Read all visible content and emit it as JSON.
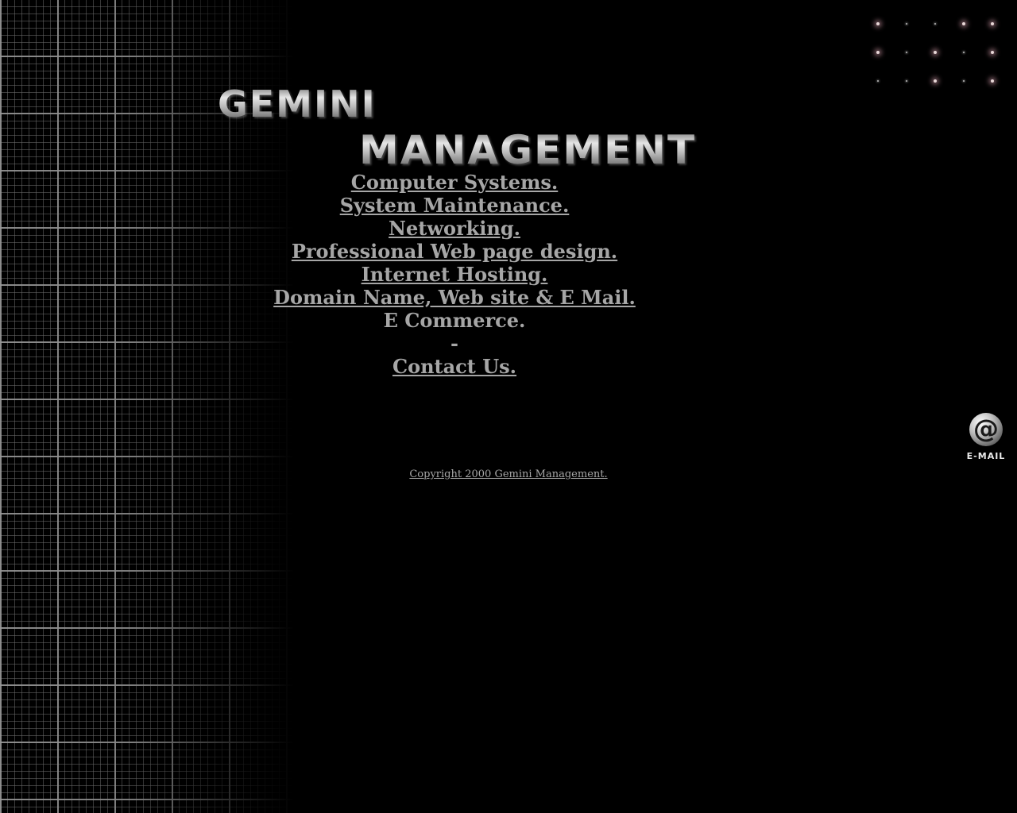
{
  "logo": {
    "line1": "GEMINI",
    "line2": "MANAGEMENT"
  },
  "menu": {
    "items": [
      {
        "label": "Computer Systems.",
        "link": true
      },
      {
        "label": "System Maintenance.",
        "link": true
      },
      {
        "label": "Networking.",
        "link": true
      },
      {
        "label": "Professional Web page design.",
        "link": true
      },
      {
        "label": "Internet Hosting.",
        "link": true
      },
      {
        "label": "Domain Name, Web site & E Mail.",
        "link": true
      },
      {
        "label": "E Commerce.",
        "link": false
      },
      {
        "label": "-",
        "link": false
      },
      {
        "label": "Contact Us.",
        "link": true
      }
    ]
  },
  "email": {
    "symbol": "@",
    "label": "E-MAIL",
    "icon": "at-icon"
  },
  "footer": {
    "copyright": "Copyright 2000 Gemini Management."
  },
  "colors": {
    "background": "#000000",
    "text": "#a6a6a6",
    "grid": "#969696",
    "dot_glow": "#966e78"
  }
}
